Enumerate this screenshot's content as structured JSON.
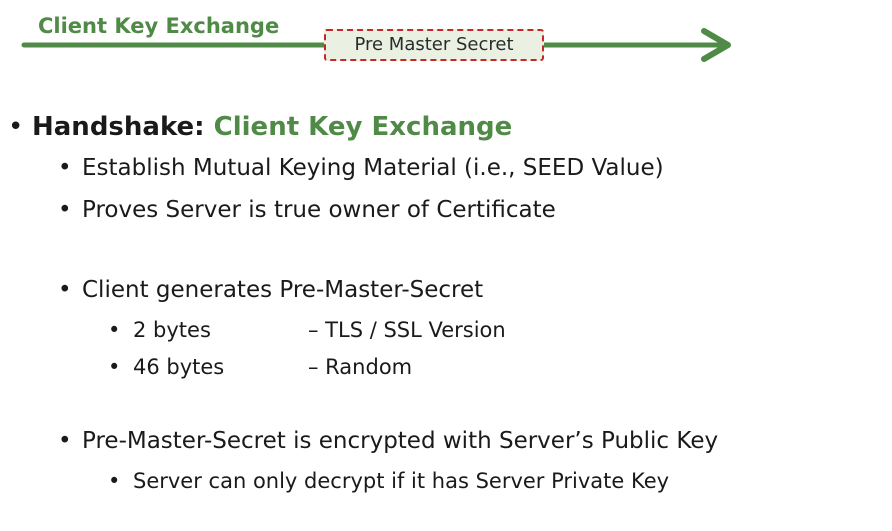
{
  "header": {
    "arrow_label": "Client Key Exchange",
    "message_label": "Pre Master Secret",
    "colors": {
      "arrow": "#4f8a47",
      "box_border": "#c62828",
      "box_fill": "#eaf1e2"
    }
  },
  "content": {
    "heading_prefix": "Handshake:",
    "heading_topic": "Client Key Exchange",
    "bullet_char": "•",
    "purpose_1": "Establish Mutual Keying Material  (i.e., SEED Value)",
    "purpose_2": "Proves Server is true owner of Certificate",
    "generates": "Client generates Pre-Master-Secret",
    "parts": [
      {
        "size": "2 bytes",
        "desc": "– TLS / SSL Version"
      },
      {
        "size": "46 bytes",
        "desc": "– Random"
      }
    ],
    "encrypted": "Pre-Master-Secret is encrypted with Server’s Public Key",
    "decrypt_note": "Server can only decrypt if it has Server Private Key"
  }
}
